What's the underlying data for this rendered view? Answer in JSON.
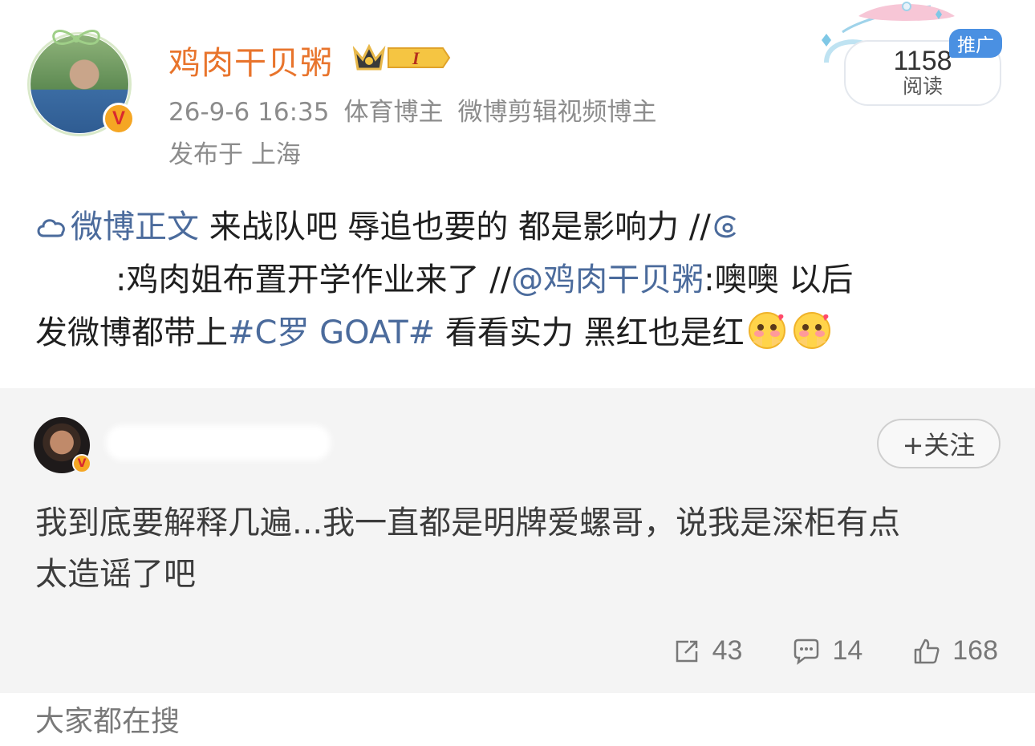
{
  "post": {
    "username": "鸡肉干贝粥",
    "level_badge": "I",
    "timestamp": "26-9-6 16:35",
    "tag_sports": "体育博主",
    "tag_video": "微博剪辑视频博主",
    "location": "发布于 上海",
    "read_count": "1158",
    "read_label": "阅读",
    "ad_tag": "推广",
    "body": {
      "line1_link": "微博正文",
      "line1_text": " 来战队吧 辱追也要的 都是影响力 //",
      "line2_text": ":鸡肉姐布置开学作业来了 //",
      "line2_mention": "@鸡肉干贝粥",
      "line2_tail": ":噢噢 以后",
      "line3_text": "发微博都带上",
      "line3_hashtag": "#C罗 GOAT#",
      "line3_tail": " 看看实力 黑红也是红"
    }
  },
  "comment": {
    "follow_label": "+关注",
    "text_line1": "我到底要解释几遍...我一直都是明牌爱螺哥，说我是深柜有点",
    "text_line2": "太造谣了吧",
    "reposts": "43",
    "comments": "14",
    "likes": "168"
  },
  "footer": {
    "label": "大家都在搜"
  },
  "icons": [
    "verified-v-icon",
    "crown-icon",
    "cloud-icon",
    "at-swirl-icon",
    "blush-emoji-icon",
    "repost-icon",
    "comment-icon",
    "like-icon"
  ],
  "colors": {
    "username": "#e8742c",
    "link": "#4b6b9c",
    "ad_tag": "#4a90e2",
    "verified": "#f5a623"
  }
}
